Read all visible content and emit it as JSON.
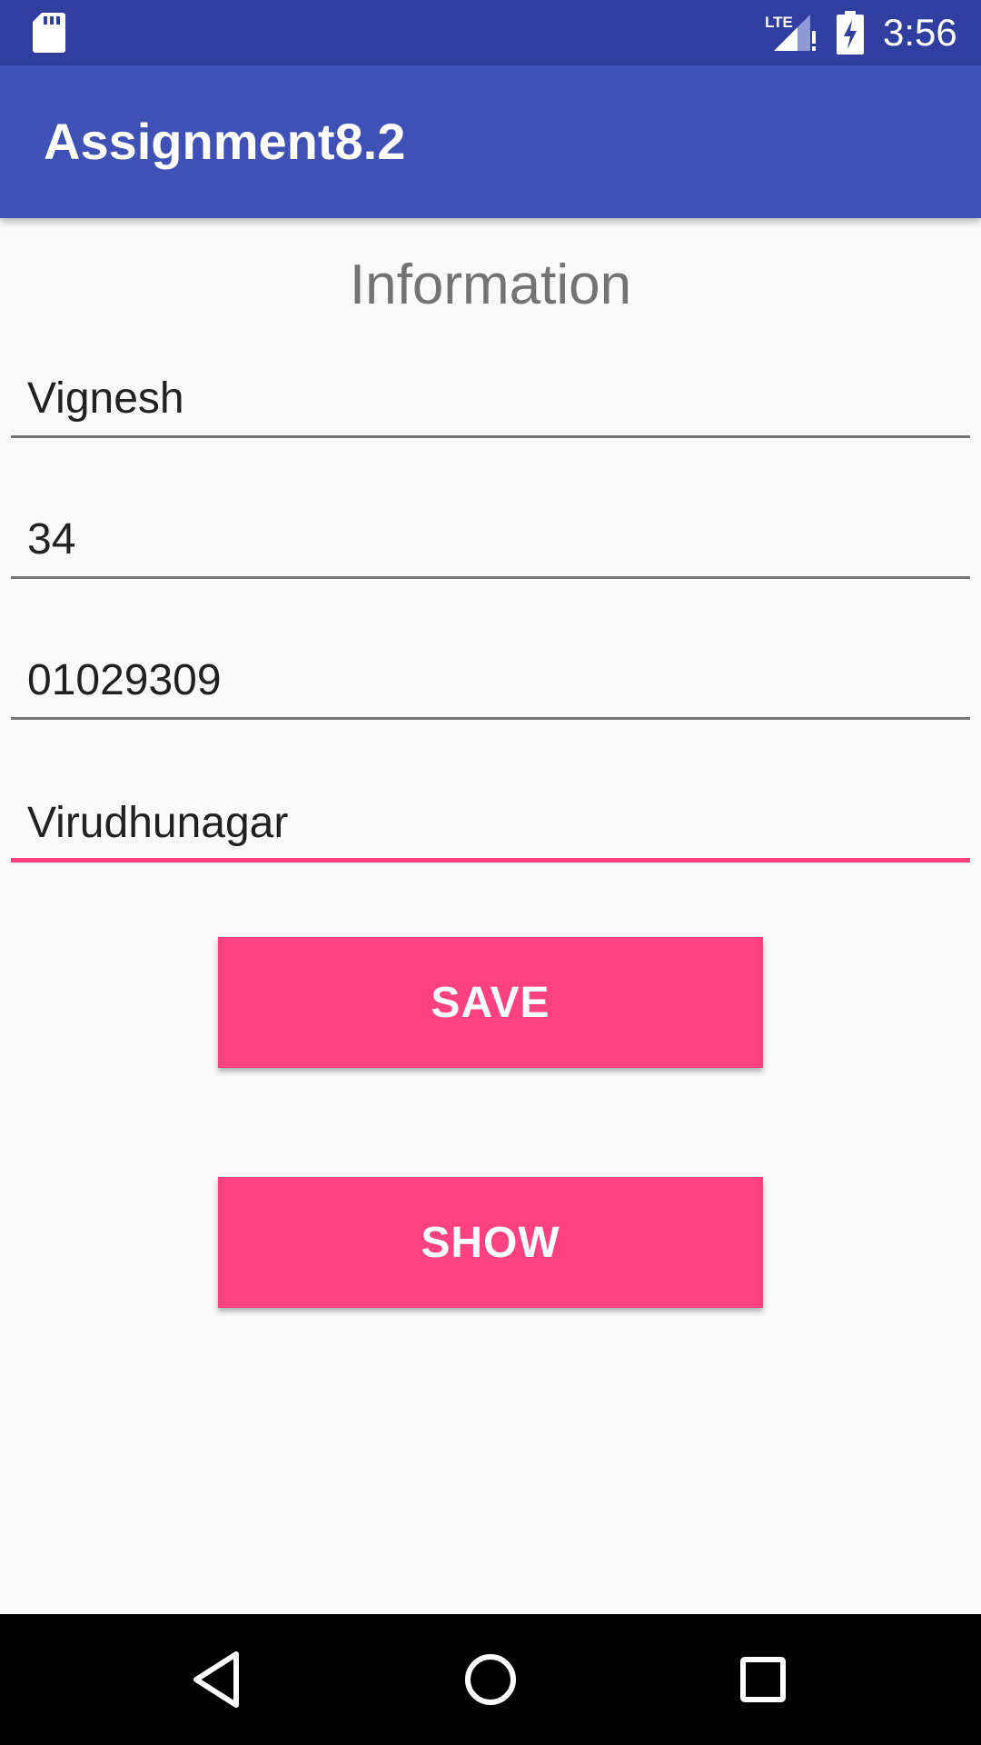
{
  "status_bar": {
    "time": "3:56",
    "network_label": "LTE",
    "icons": [
      "sd-card-icon",
      "lte-signal-icon",
      "battery-charging-icon"
    ]
  },
  "app_bar": {
    "title": "Assignment8.2"
  },
  "form": {
    "heading": "Information",
    "name_value": "Vignesh",
    "age_value": "34",
    "phone_value": "01029309",
    "city_value": "Virudhunagar"
  },
  "buttons": {
    "save_label": "SAVE",
    "show_label": "SHOW"
  },
  "nav_bar": {
    "icons": [
      "back-icon",
      "home-icon",
      "recents-icon"
    ]
  },
  "colors": {
    "status_bar": "#303f9f",
    "primary": "#3f51b5",
    "accent": "#ff4081",
    "background": "#fafafa"
  }
}
